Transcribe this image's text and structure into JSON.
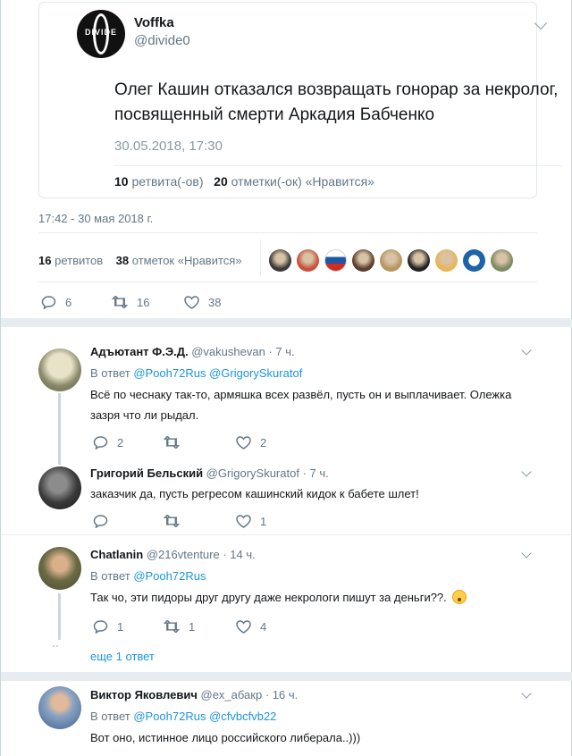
{
  "quoted_tweet": {
    "author_name": "Voffka",
    "author_handle": "@divide0",
    "avatar_text": "DIVIDE",
    "text": "Олег Кашин отказался возвращать гонорар за некролог, посвященный смерти Аркадия Бабченко",
    "date": "30.05.2018, 17:30",
    "retweets_count": "10",
    "retweets_label": "ретвита(-ов)",
    "likes_count": "20",
    "likes_label": "отметки(-ок) «Нравится»"
  },
  "tweet_meta": {
    "timestamp": "17:42 - 30 мая 2018 г.",
    "retweets_count": "16",
    "retweets_label": "ретвитов",
    "likes_count": "38",
    "likes_label": "отметок «Нравится»",
    "liker_colors": [
      "#3a3a3a",
      "#c7503c",
      "#ffffff",
      "#5a3d2b",
      "#b59663",
      "#222222",
      "#e8b55a",
      "#1d63a6",
      "#7d8b62"
    ]
  },
  "tweet_actions": {
    "replies": "6",
    "retweets": "16",
    "likes": "38"
  },
  "replies": [
    {
      "name": "Адъютант Ф.Э.Д.",
      "handle": "@vakushevan",
      "time": "· 7 ч.",
      "reply_prefix": "В ответ",
      "reply_to": "@Pooh72Rus @GrigorySkuratof",
      "text": "Всё по чеснаку так-то,  армяшка всех развёл, пусть он и выплачивает. Олежка зазря что ли рыдал.",
      "replies": "2",
      "retweets": "",
      "likes": "2"
    },
    {
      "name": "Григорий Бельский",
      "handle": "@GrigorySkuratof",
      "time": "· 7 ч.",
      "text": "заказчик да, пусть регресом кашинский кидок к бабете шлет!",
      "replies": "",
      "retweets": "",
      "likes": "1"
    },
    {
      "name": "Chatlanin",
      "handle": "@216vtenture",
      "time": "· 14 ч.",
      "reply_prefix": "В ответ",
      "reply_to": "@Pooh72Rus",
      "text": "Так чо, эти пидоры друг другу даже некрологи пишут за деньги??.",
      "replies": "1",
      "retweets": "1",
      "likes": "4"
    },
    {
      "name": "Виктор Яковлевич",
      "handle": "@ex_абакр",
      "time": "· 16 ч.",
      "reply_prefix": "В ответ",
      "reply_to": "@Pooh72Rus @cfvbcfvb22",
      "text": "Вот оно, истинное лицо российского либерала..)))"
    }
  ],
  "more_replies_label": "еще 1 ответ"
}
